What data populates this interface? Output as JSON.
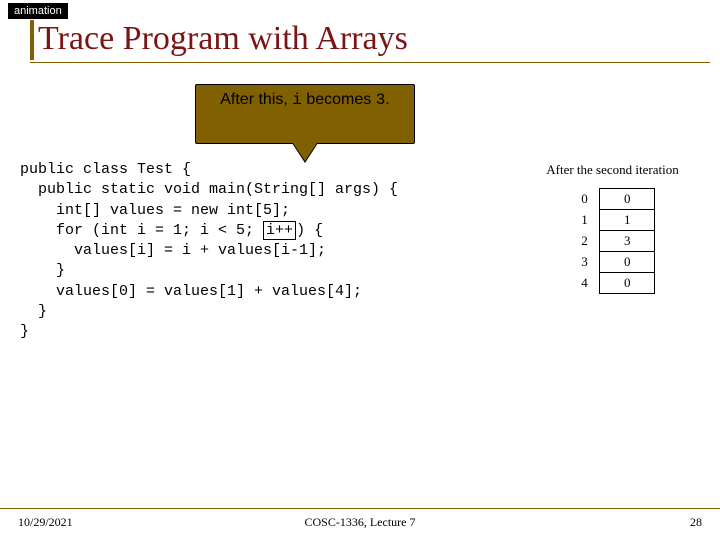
{
  "tag": "animation",
  "title": "Trace Program with Arrays",
  "callout": {
    "prefix": "After this, ",
    "var": "i",
    "mid": " becomes ",
    "val": "3",
    "suffix": "."
  },
  "code": {
    "l1": "public class Test {",
    "l2": "  public static void main(String[] args) {",
    "l3": "    int[] values = new int[5];",
    "l4a": "    for (int i = 1; i < 5; ",
    "l4hl": "i++",
    "l4b": ") {",
    "l5": "      values[i] = i + values[i-1];",
    "l6": "    }",
    "l7": "    values[0] = values[1] + values[4];",
    "l8": "  }",
    "l9": "}"
  },
  "diagram": {
    "caption": "After the second iteration",
    "rows": [
      {
        "index": "0",
        "value": "0"
      },
      {
        "index": "1",
        "value": "1"
      },
      {
        "index": "2",
        "value": "3"
      },
      {
        "index": "3",
        "value": "0"
      },
      {
        "index": "4",
        "value": "0"
      }
    ]
  },
  "footer": {
    "date": "10/29/2021",
    "center": "COSC-1336, Lecture 7",
    "page": "28"
  }
}
